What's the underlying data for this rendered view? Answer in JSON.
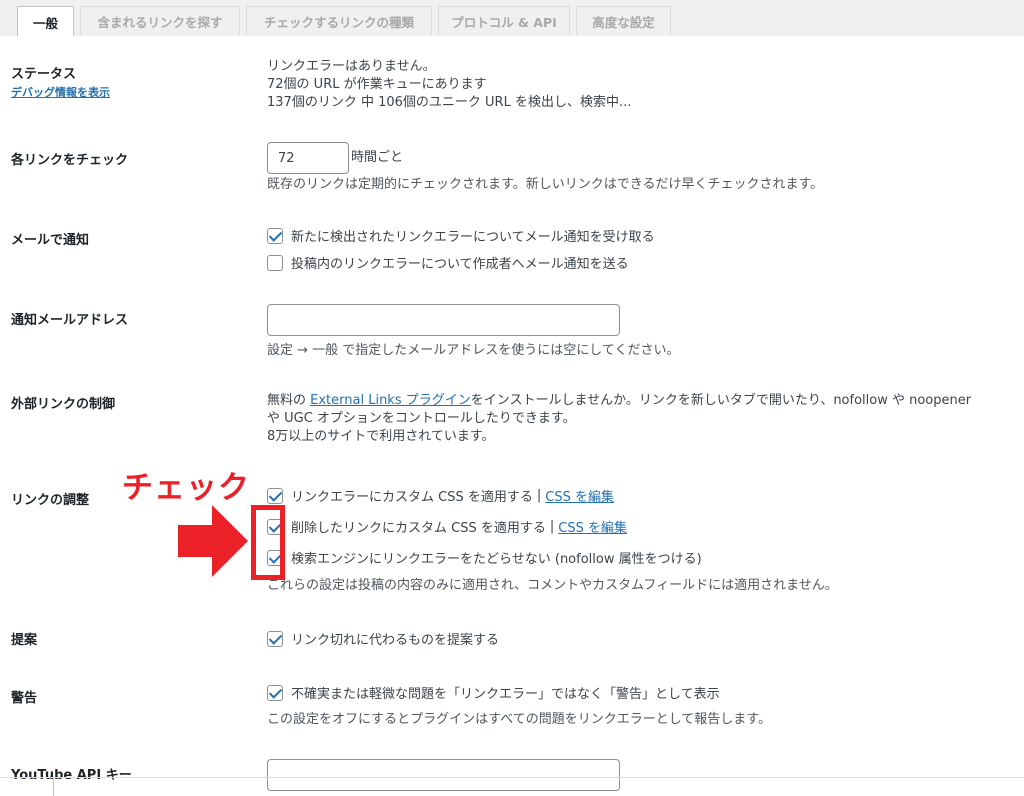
{
  "tabs": [
    {
      "label": "一般"
    },
    {
      "label": "含まれるリンクを探す"
    },
    {
      "label": "チェックするリンクの種類"
    },
    {
      "label": "プロトコル & API"
    },
    {
      "label": "高度な設定"
    }
  ],
  "status": {
    "label": "ステータス",
    "debug_link": "デバッグ情報を表示",
    "line1": "リンクエラーはありません。",
    "line2": "72個の URL が作業キューにあります",
    "line3": "137個のリンク 中 106個のユニーク URL を検出し、検索中..."
  },
  "check_each": {
    "label": "各リンクをチェック",
    "value": "72",
    "unit": "時間ごと",
    "desc": "既存のリンクは定期的にチェックされます。新しいリンクはできるだけ早くチェックされます。"
  },
  "email_notify": {
    "label": "メールで通知",
    "opt1": "新たに検出されたリンクエラーについてメール通知を受け取る",
    "opt2": "投稿内のリンクエラーについて作成者へメール通知を送る"
  },
  "notify_address": {
    "label": "通知メールアドレス",
    "value": "",
    "desc": "設定 → 一般 で指定したメールアドレスを使うには空にしてください。"
  },
  "external": {
    "label": "外部リンクの制御",
    "pre": "無料の ",
    "link": "External Links プラグイン",
    "post": "をインストールしませんか。リンクを新しいタブで開いたり、nofollow や noopener",
    "line2": "や UGC オプションをコントロールしたりできます。",
    "line3": "8万以上のサイトで利用されています。"
  },
  "tweaks": {
    "label": "リンクの調整",
    "opt1": "リンクエラーにカスタム CSS を適用する",
    "opt2": "削除したリンクにカスタム CSS を適用する",
    "opt3": "検索エンジンにリンクエラーをたどらせない (nofollow 属性をつける)",
    "sep": "|",
    "edit_css": "CSS を編集",
    "desc": "これらの設定は投稿の内容のみに適用され、コメントやカスタムフィールドには適用されません。"
  },
  "suggest": {
    "label": "提案",
    "opt": "リンク切れに代わるものを提案する"
  },
  "warning": {
    "label": "警告",
    "opt": "不確実または軽微な問題を「リンクエラー」ではなく「警告」として表示",
    "desc": "この設定をオフにするとプラグインはすべての問題をリンクエラーとして報告します。"
  },
  "youtube": {
    "label": "YouTube API キー"
  },
  "annotation": {
    "text": "チェック",
    "color": "#ec2027"
  },
  "colors": {
    "link": "#2271b1",
    "check": "#2271b1"
  }
}
